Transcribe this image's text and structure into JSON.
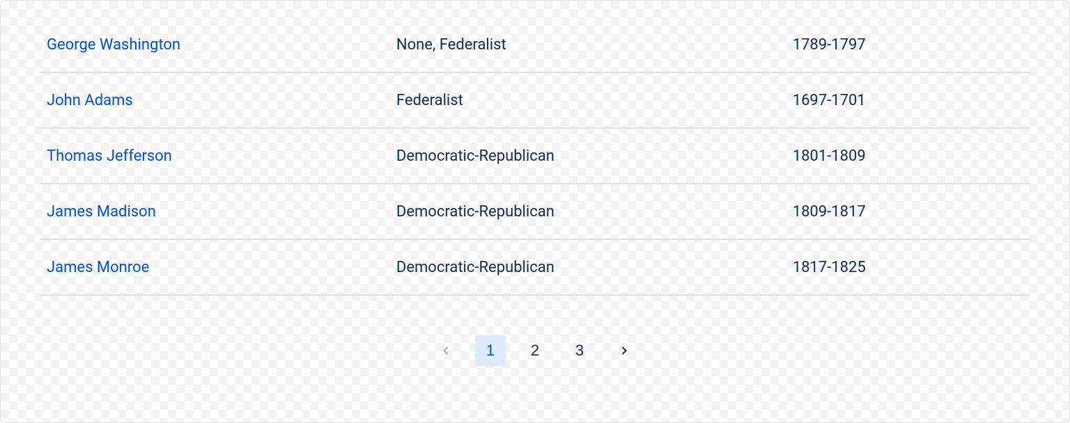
{
  "rows": [
    {
      "name": "George Washington",
      "party": "None, Federalist",
      "term": "1789-1797"
    },
    {
      "name": "John Adams",
      "party": "Federalist",
      "term": "1697-1701"
    },
    {
      "name": "Thomas Jefferson",
      "party": "Democratic-Republican",
      "term": "1801-1809"
    },
    {
      "name": "James Madison",
      "party": "Democratic-Republican",
      "term": "1809-1817"
    },
    {
      "name": "James Monroe",
      "party": "Democratic-Republican",
      "term": "1817-1825"
    }
  ],
  "pagination": {
    "pages": [
      "1",
      "2",
      "3"
    ],
    "current": "1"
  }
}
